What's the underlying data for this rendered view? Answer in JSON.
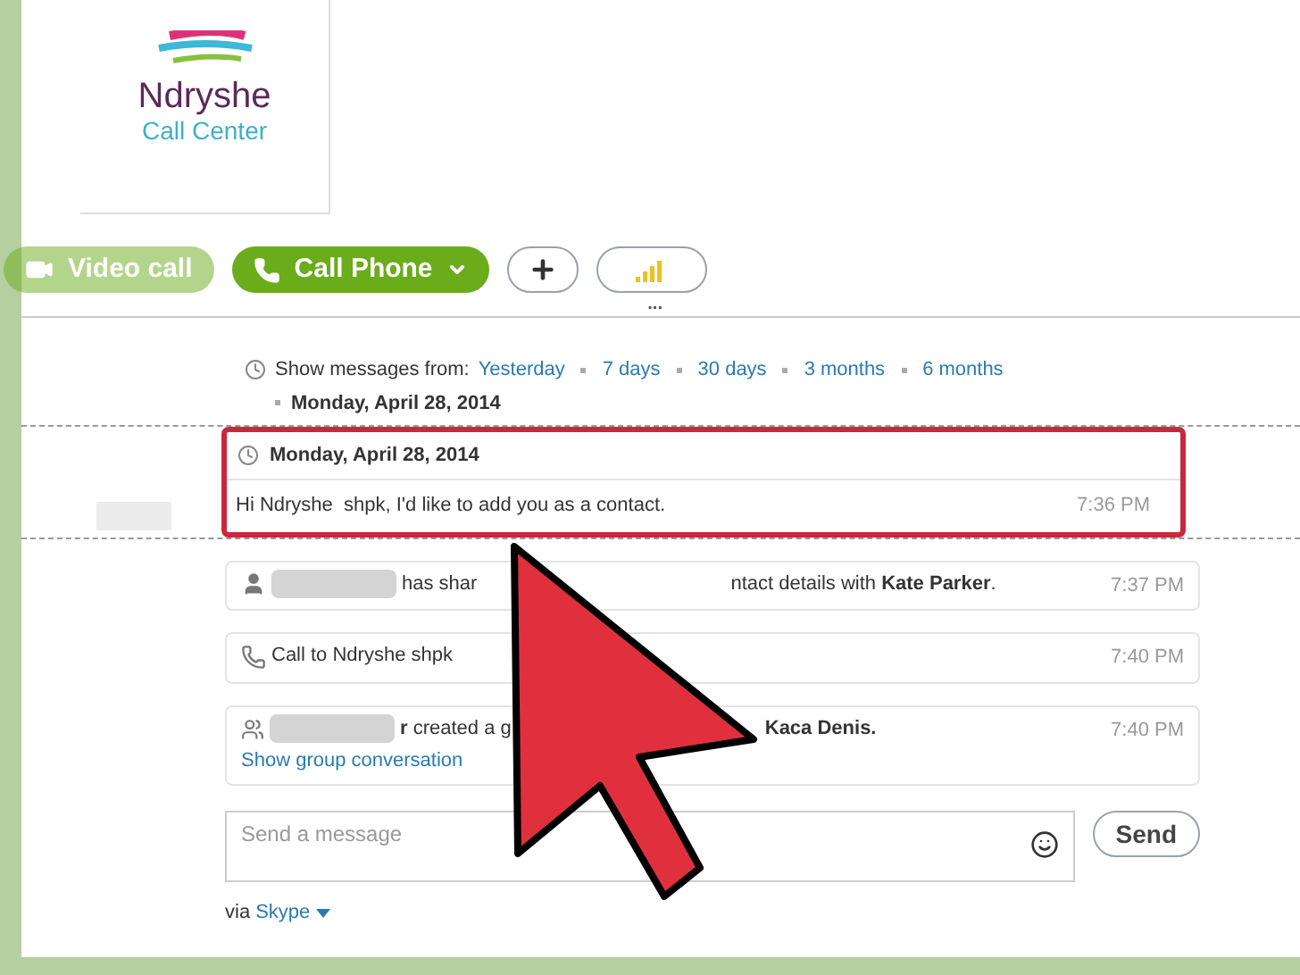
{
  "logo": {
    "name": "Ndryshe",
    "subtitle": "Call Center"
  },
  "call_bar": [
    {
      "kind": "video",
      "label": "Video call",
      "disabled": true
    },
    {
      "kind": "call",
      "label": "Call Phone",
      "disabled": false
    },
    {
      "kind": "add",
      "disabled": false
    },
    {
      "kind": "signal",
      "disabled": false
    }
  ],
  "more": "...",
  "history": {
    "label": "Show messages from:",
    "links": [
      "Yesterday",
      "7 days",
      "30 days",
      "3 months",
      "6 months"
    ],
    "date": "Monday, April 28, 2014"
  },
  "highlighted": {
    "date": "Monday, April 28, 2014",
    "text": "Hi Ndryshe  shpk, I'd like to add you as a contact.",
    "time": "7:36 PM"
  },
  "events": [
    {
      "kind": "contact",
      "before": "has shar",
      "after": "ntact details with **Kate Parker**.",
      "time": "7:37 PM"
    },
    {
      "kind": "call",
      "before": "Call to Ndryshe  shpk",
      "time": "7:40 PM"
    },
    {
      "kind": "group",
      "before": "**r** created a g",
      "after": "Kaca Denis.",
      "link": "Show group conversation",
      "time": "7:40 PM"
    }
  ],
  "composer": {
    "placeholder": "Send a message",
    "send": "Send"
  },
  "via": {
    "prefix": "via",
    "link": "Skype"
  }
}
